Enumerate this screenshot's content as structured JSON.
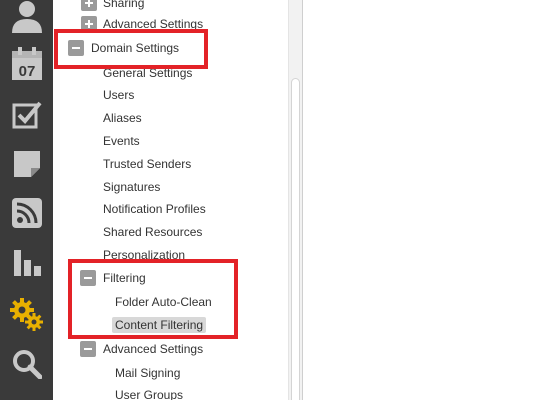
{
  "rail": {
    "background": "#3a3a3a",
    "icons": [
      "user-icon",
      "calendar-icon",
      "tasks-icon",
      "notes-icon",
      "rss-icon",
      "reports-icon",
      "settings-icon",
      "search-icon"
    ],
    "calendar_day": "07",
    "active_icon_color": "#e8b000"
  },
  "tree": {
    "items": [
      {
        "label": "Sharing",
        "expander": "plus"
      },
      {
        "label": "Advanced Settings",
        "expander": "plus"
      },
      {
        "label": "Domain Settings",
        "expander": "minus"
      },
      {
        "label": "General Settings"
      },
      {
        "label": "Users"
      },
      {
        "label": "Aliases"
      },
      {
        "label": "Events"
      },
      {
        "label": "Trusted Senders"
      },
      {
        "label": "Signatures"
      },
      {
        "label": "Notification Profiles"
      },
      {
        "label": "Shared Resources"
      },
      {
        "label": "Personalization"
      },
      {
        "label": "Filtering",
        "expander": "minus"
      },
      {
        "label": "Folder Auto-Clean"
      },
      {
        "label": "Content Filtering",
        "selected": true
      },
      {
        "label": "Advanced Settings",
        "expander": "minus"
      },
      {
        "label": "Mail Signing"
      },
      {
        "label": "User Groups"
      }
    ]
  },
  "annotations": {
    "color": "#e32227"
  }
}
